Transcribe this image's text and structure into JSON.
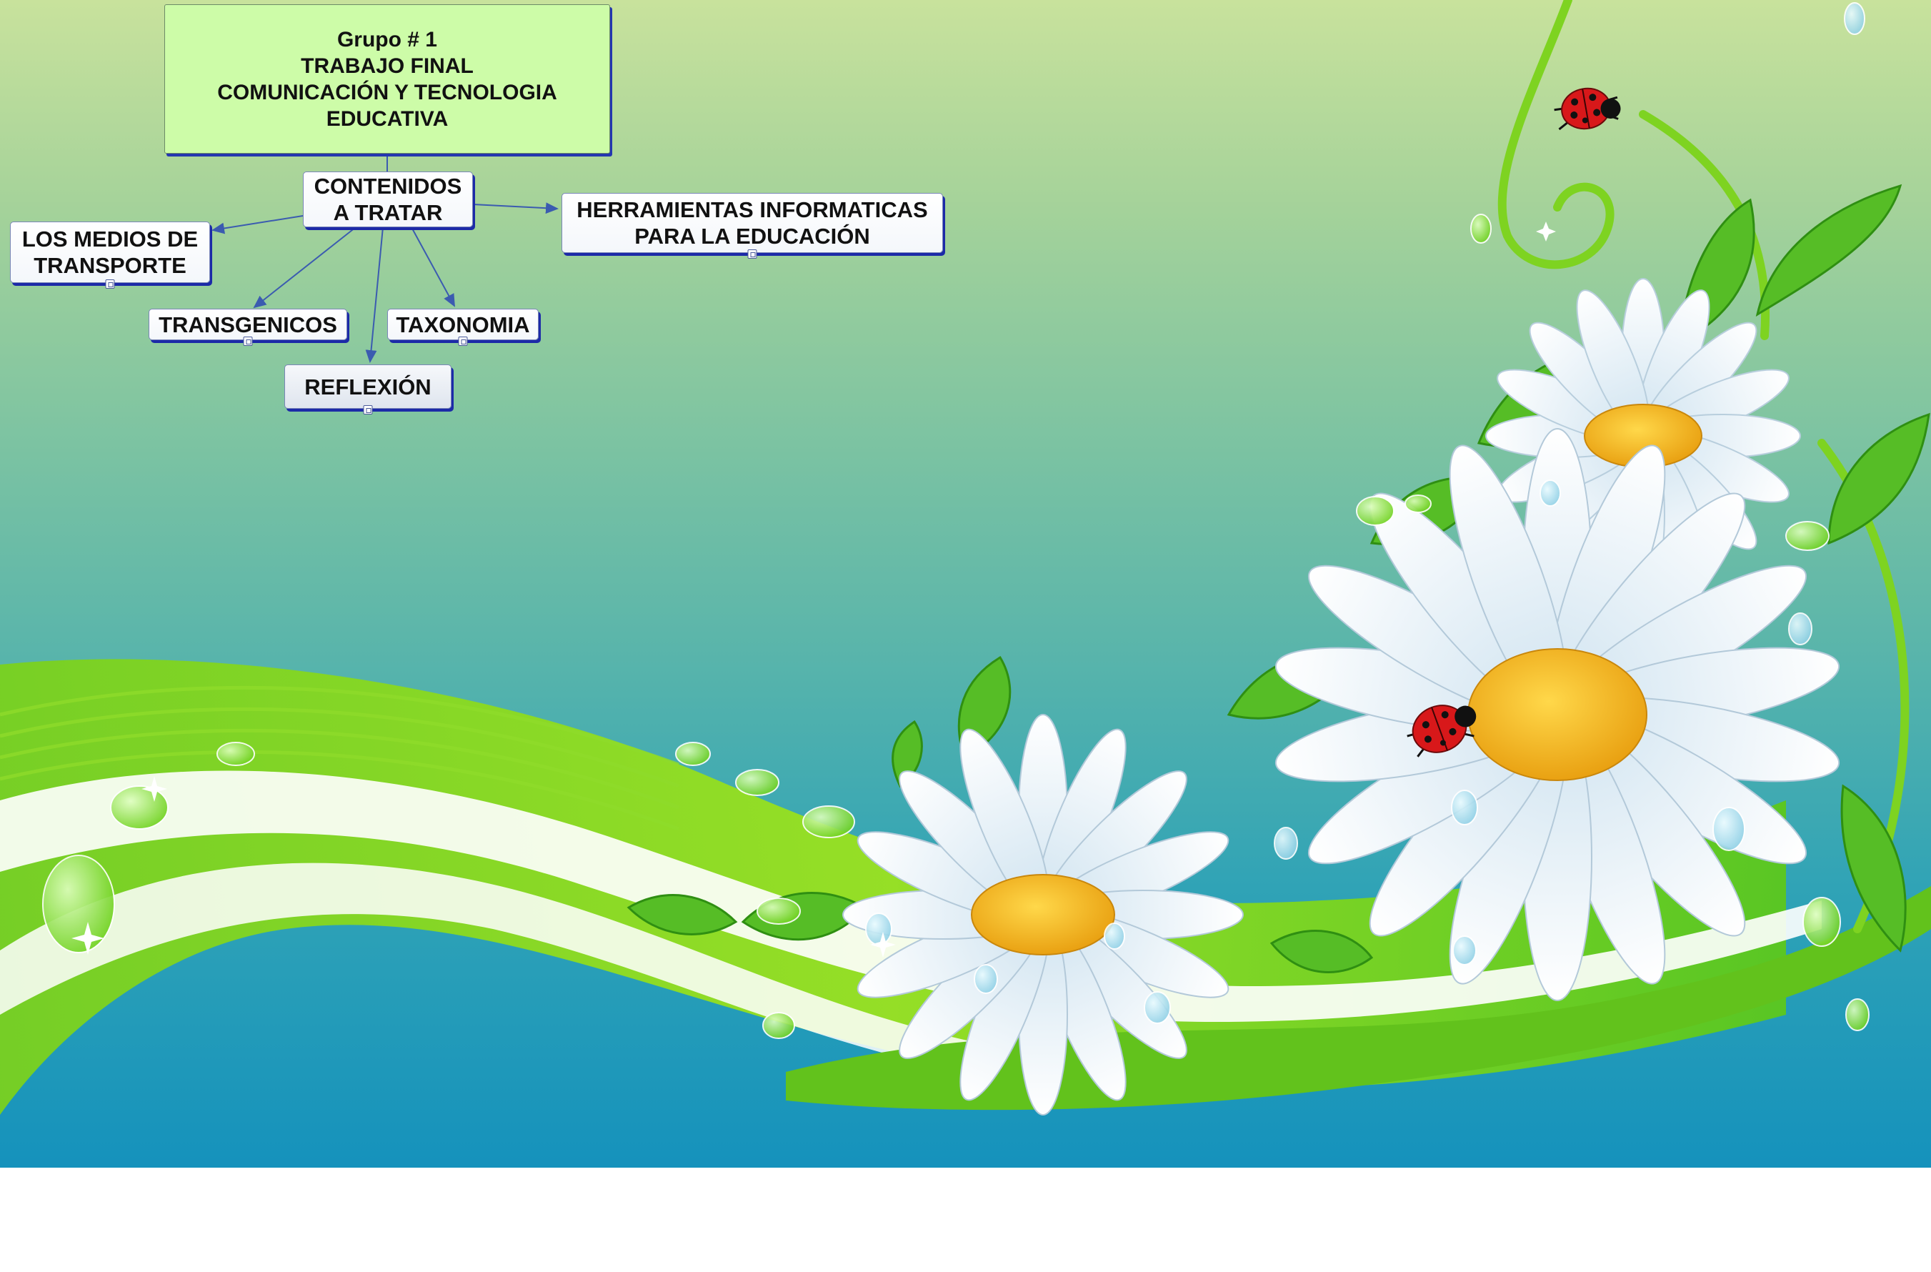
{
  "concept_map": {
    "title": "Grupo # 1\nTRABAJO FINAL\nCOMUNICACIÓN Y TECNOLOGIA\nEDUCATIVA",
    "central_node": "CONTENIDOS\nA TRATAR",
    "topics": [
      "LOS MEDIOS DE\nTRANSPORTE",
      "TRANSGENICOS",
      "TAXONOMIA",
      "REFLEXIÓN",
      "HERRAMIENTAS INFORMATICAS\nPARA LA EDUCACIÓN"
    ]
  },
  "colors": {
    "title_fill": "#cdfca8",
    "node_fill": "#ffffff",
    "node_shadow": "#1c2aa8",
    "connector": "#3b5bb0",
    "petal": "#ffffff",
    "flower_center": "#f2b81c",
    "leaf": "#5ec42a",
    "ladybug": "#d8181a"
  },
  "icons": [
    "attachment-icon",
    "ladybug-icon",
    "daisy-flower-icon",
    "water-drop-icon"
  ]
}
